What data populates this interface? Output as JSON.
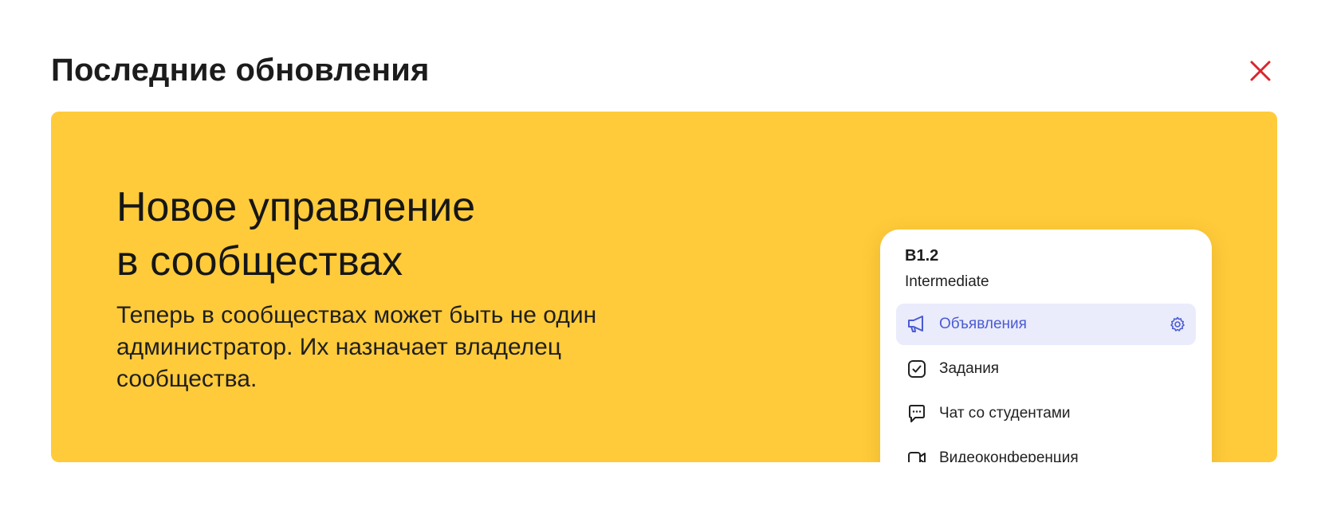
{
  "modal": {
    "title": "Последние обновления",
    "close_icon": "close-icon",
    "accent_color": "#d9262b"
  },
  "banner": {
    "background_color": "#ffcb3a",
    "title_line1": "Новое управление",
    "title_line2": "в сообществах",
    "description": "Теперь в сообществах может быть не один администратор. Их назначает владелец сообщества."
  },
  "preview_card": {
    "level": "B1.2",
    "sublevel": "Intermediate",
    "items": [
      {
        "label": "Объявления",
        "icon": "megaphone-icon",
        "active": true,
        "settings_icon": "gear-icon"
      },
      {
        "label": "Задания",
        "icon": "checkbox-icon",
        "active": false
      },
      {
        "label": "Чат со студентами",
        "icon": "chat-bubble-icon",
        "active": false
      },
      {
        "label": "Видеоконференция",
        "icon": "video-camera-icon",
        "active": false
      }
    ],
    "active_color": "#4a5bd2",
    "active_background": "#eaebfb"
  }
}
